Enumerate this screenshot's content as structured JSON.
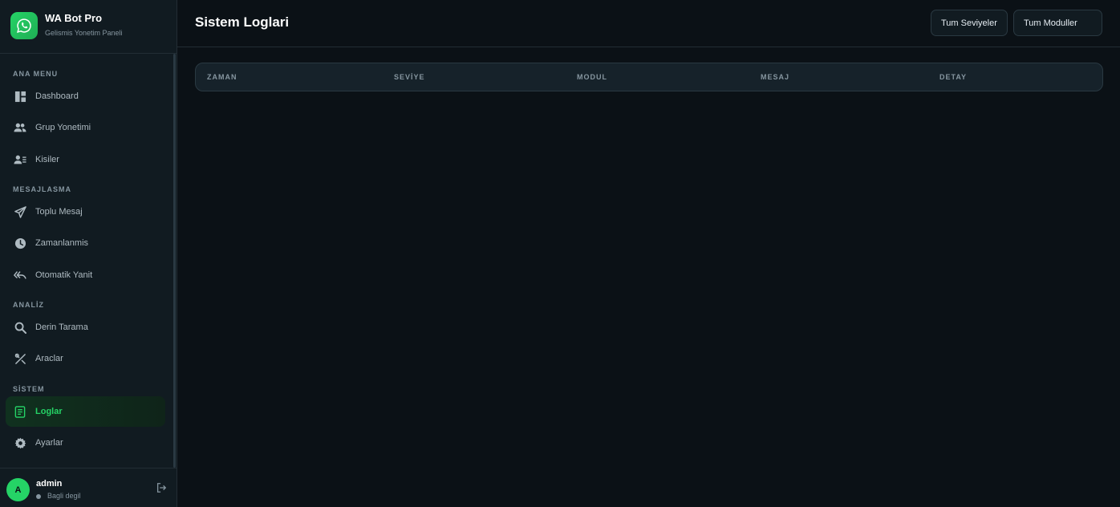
{
  "brand": {
    "title": "WA Bot Pro",
    "subtitle": "Gelismis Yonetim Paneli",
    "logo_icon": "whatsapp-icon",
    "accent": "#25d366"
  },
  "sidebar": {
    "sections": {
      "main": "ANA MENU",
      "messaging": "MESAJLASMA",
      "analysis": "ANALİZ",
      "system": "SİSTEM"
    },
    "items": [
      {
        "label": "Dashboard",
        "icon": "dashboard-icon"
      },
      {
        "label": "Grup Yonetimi",
        "icon": "group-icon"
      },
      {
        "label": "Kisiler",
        "icon": "contacts-icon"
      },
      {
        "label": "Toplu Mesaj",
        "icon": "send-icon"
      },
      {
        "label": "Zamanlanmis",
        "icon": "clock-icon"
      },
      {
        "label": "Otomatik Yanit",
        "icon": "reply-all-icon"
      },
      {
        "label": "Derin Tarama",
        "icon": "search-icon"
      },
      {
        "label": "Araclar",
        "icon": "tools-icon"
      },
      {
        "label": "Loglar",
        "icon": "log-icon",
        "active": true
      },
      {
        "label": "Ayarlar",
        "icon": "gear-icon"
      }
    ]
  },
  "user": {
    "initial": "A",
    "name": "admin",
    "status": "Bagli degil"
  },
  "header": {
    "title": "Sistem Loglari",
    "filter_levels": "Tum Seviyeler",
    "filter_modules": "Tum Moduller"
  },
  "table": {
    "columns": [
      "ZAMAN",
      "SEVİYE",
      "MODUL",
      "MESAJ",
      "DETAY"
    ],
    "rows": []
  }
}
